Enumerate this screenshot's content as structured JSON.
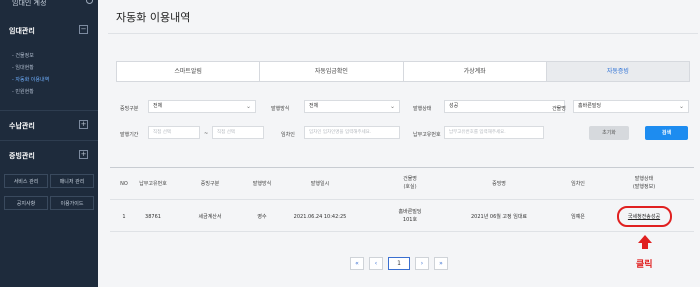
{
  "sidebar": {
    "account_label": "임대인 계정",
    "sections": [
      {
        "title": "임대관리",
        "toggle": "−"
      },
      {
        "title": "수납관리",
        "toggle": "+"
      },
      {
        "title": "증빙관리",
        "toggle": "+"
      }
    ],
    "sub_items": [
      "- 건물정보",
      "- 임대현황",
      "- 자동화 이용내역",
      "- 민원현황"
    ],
    "buttons": [
      "서비스 관리",
      "매니저 관리",
      "공지사항",
      "이용가이드"
    ]
  },
  "page": {
    "title": "자동화 이용내역"
  },
  "tabs": [
    {
      "label": "스마트알림",
      "active": false
    },
    {
      "label": "자동입금확인",
      "active": false
    },
    {
      "label": "가상계좌",
      "active": false
    },
    {
      "label": "자동증빙",
      "active": true
    }
  ],
  "filters": {
    "proof_type_label": "증빙구분",
    "proof_type_value": "전체",
    "issue_method_label": "발행방식",
    "issue_method_value": "전체",
    "issue_status_label": "발행상태",
    "issue_status_value": "성공",
    "building_label": "건물명",
    "building_value": "홈바른빌딩",
    "period_label": "발행기간",
    "date_start_placeholder": "직접 선택",
    "date_sep": "~",
    "date_end_placeholder": "직접 선택",
    "tenant_label": "임차인",
    "tenant_placeholder": "임차인 임차인명을 입력해주세요.",
    "payer_no_label": "납부고유번호",
    "payer_no_placeholder": "납부고유번호를 입력해주세요.",
    "reset_label": "초기화",
    "search_label": "검색"
  },
  "table": {
    "headers": [
      "NO",
      "납부고유번호",
      "증빙구분",
      "발행방식",
      "발행일시",
      "건물명\n(호실)",
      "증빙명",
      "임차인",
      "발행상태\n(발행정보)"
    ],
    "rows": [
      {
        "no": "1",
        "payer_no": "38761",
        "proof_type": "세금계산서",
        "issue_method": "영수",
        "issued_at": "2021.06.24 10:42:25",
        "building": "홈바른빌딩\n101호",
        "proof_name": "2021년 06월 고정 임대료",
        "tenant": "임예은",
        "status": "국세청전송성공"
      }
    ]
  },
  "pagination": {
    "first": "«",
    "prev": "‹",
    "current": "1",
    "next": "›",
    "last": "»"
  },
  "annotation": {
    "label": "클릭",
    "color": "#e02020"
  },
  "colors": {
    "sidebar_bg": "#1e2b3c",
    "accent": "#1d8cf0",
    "active_tab_text": "#2a6fd6"
  }
}
